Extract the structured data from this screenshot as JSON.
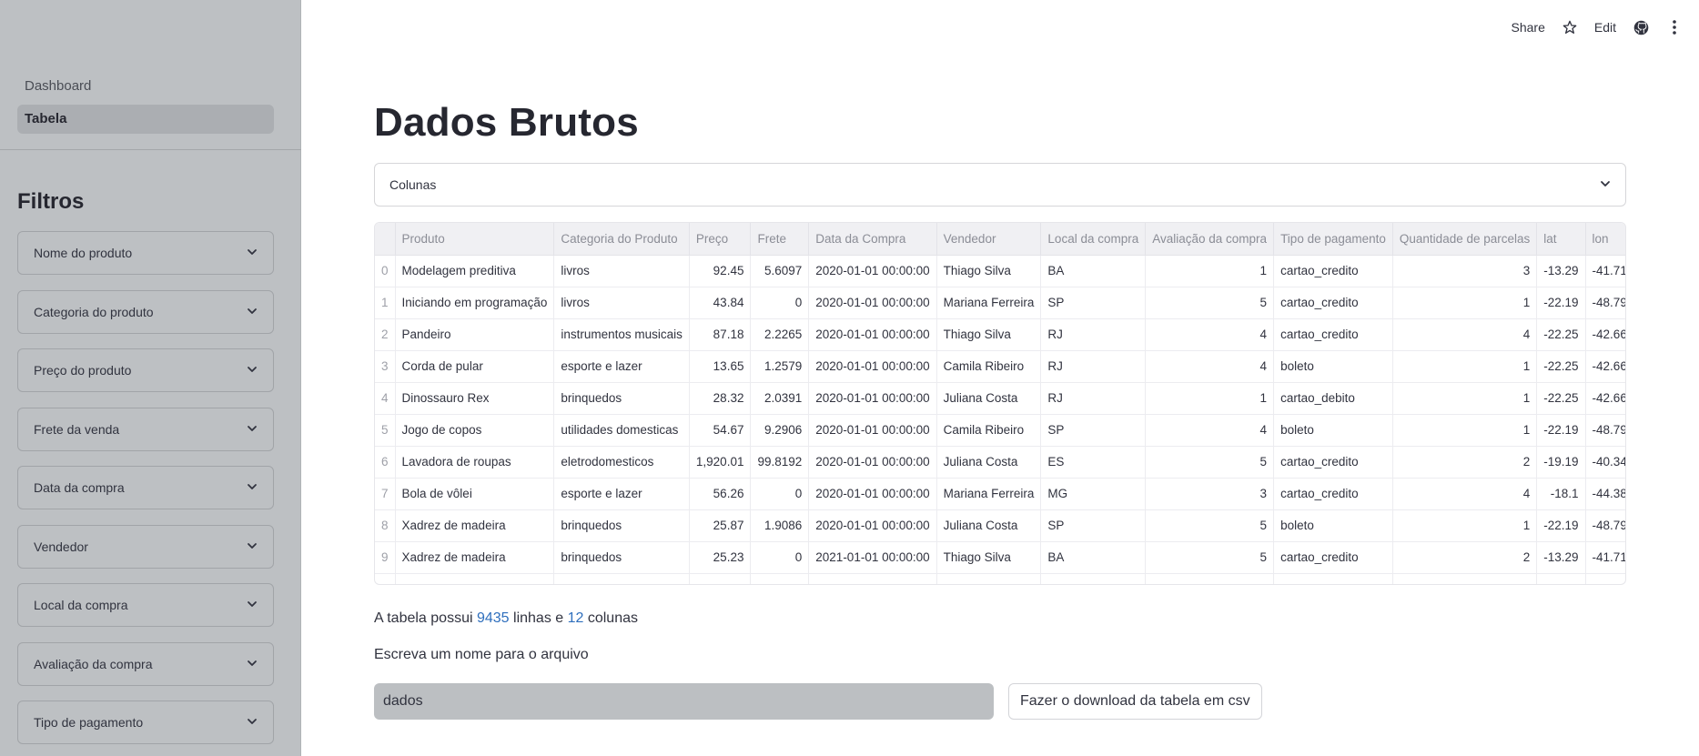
{
  "sidebar": {
    "nav": [
      {
        "label": "Dashboard",
        "active": false
      },
      {
        "label": "Tabela",
        "active": true
      }
    ],
    "filters_title": "Filtros",
    "filters": [
      "Nome do produto",
      "Categoria do produto",
      "Preço do produto",
      "Frete da venda",
      "Data da compra",
      "Vendedor",
      "Local da compra",
      "Avaliação da compra",
      "Tipo de pagamento"
    ]
  },
  "toolbar": {
    "share_label": "Share",
    "star_icon": "star-icon",
    "edit_label": "Edit",
    "github_icon": "github-icon",
    "menu_icon": "more-vertical-icon"
  },
  "main": {
    "title": "Dados Brutos",
    "expander_label": "Colunas",
    "table": {
      "columns": [
        "",
        "Produto",
        "Categoria do Produto",
        "Preço",
        "Frete",
        "Data da Compra",
        "Vendedor",
        "Local da compra",
        "Avaliação da compra",
        "Tipo de pagamento",
        "Quantidade de parcelas",
        "lat",
        "lon"
      ],
      "rows": [
        [
          "0",
          "Modelagem preditiva",
          "livros",
          "92.45",
          "5.6097",
          "2020-01-01 00:00:00",
          "Thiago Silva",
          "BA",
          "1",
          "cartao_credito",
          "3",
          "-13.29",
          "-41.71"
        ],
        [
          "1",
          "Iniciando em programação",
          "livros",
          "43.84",
          "0",
          "2020-01-01 00:00:00",
          "Mariana Ferreira",
          "SP",
          "5",
          "cartao_credito",
          "1",
          "-22.19",
          "-48.79"
        ],
        [
          "2",
          "Pandeiro",
          "instrumentos musicais",
          "87.18",
          "2.2265",
          "2020-01-01 00:00:00",
          "Thiago Silva",
          "RJ",
          "4",
          "cartao_credito",
          "4",
          "-22.25",
          "-42.66"
        ],
        [
          "3",
          "Corda de pular",
          "esporte e lazer",
          "13.65",
          "1.2579",
          "2020-01-01 00:00:00",
          "Camila Ribeiro",
          "RJ",
          "4",
          "boleto",
          "1",
          "-22.25",
          "-42.66"
        ],
        [
          "4",
          "Dinossauro Rex",
          "brinquedos",
          "28.32",
          "2.0391",
          "2020-01-01 00:00:00",
          "Juliana Costa",
          "RJ",
          "1",
          "cartao_debito",
          "1",
          "-22.25",
          "-42.66"
        ],
        [
          "5",
          "Jogo de copos",
          "utilidades domesticas",
          "54.67",
          "9.2906",
          "2020-01-01 00:00:00",
          "Camila Ribeiro",
          "SP",
          "4",
          "boleto",
          "1",
          "-22.19",
          "-48.79"
        ],
        [
          "6",
          "Lavadora de roupas",
          "eletrodomesticos",
          "1,920.01",
          "99.8192",
          "2020-01-01 00:00:00",
          "Juliana Costa",
          "ES",
          "5",
          "cartao_credito",
          "2",
          "-19.19",
          "-40.34"
        ],
        [
          "7",
          "Bola de vôlei",
          "esporte e lazer",
          "56.26",
          "0",
          "2020-01-01 00:00:00",
          "Mariana Ferreira",
          "MG",
          "3",
          "cartao_credito",
          "4",
          "-18.1",
          "-44.38"
        ],
        [
          "8",
          "Xadrez de madeira",
          "brinquedos",
          "25.87",
          "1.9086",
          "2020-01-01 00:00:00",
          "Juliana Costa",
          "SP",
          "5",
          "boleto",
          "1",
          "-22.19",
          "-48.79"
        ],
        [
          "9",
          "Xadrez de madeira",
          "brinquedos",
          "25.23",
          "0",
          "2021-01-01 00:00:00",
          "Thiago Silva",
          "BA",
          "5",
          "cartao_credito",
          "2",
          "-13.29",
          "-41.71"
        ]
      ]
    },
    "info": {
      "prefix": "A tabela possui ",
      "rows": "9435",
      "middle": " linhas e ",
      "cols": "12",
      "suffix": " colunas"
    },
    "file_label": "Escreva um nome para o arquivo",
    "file_value": "dados",
    "download_label": "Fazer o download da tabela em csv"
  }
}
